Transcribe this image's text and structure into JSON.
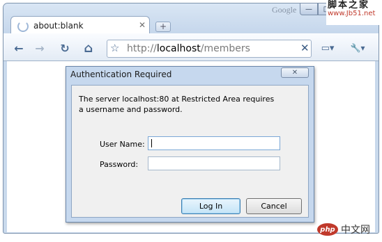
{
  "browser": {
    "brand": "Google",
    "window_controls": {
      "minimize": "—",
      "maximize": "□",
      "close": "✕"
    },
    "tab": {
      "title": "about:blank",
      "close": "✕"
    },
    "new_tab": "+",
    "address": {
      "scheme": "http://",
      "host": "localhost",
      "path": "/members"
    },
    "buttons": {
      "back": "←",
      "forward": "→",
      "reload": "↻",
      "home": "⌂",
      "star": "☆",
      "stop": "✕",
      "page": "▭▾",
      "wrench": "🔧▾"
    },
    "accent": "#4a6a92"
  },
  "watermark": {
    "top": "脚本之家",
    "bottom": "www.Jb51.net"
  },
  "dialog": {
    "title": "Authentication Required",
    "close": "✕",
    "message": "The server localhost:80 at Restricted Area requires a username and password.",
    "username_label": "User Name:",
    "password_label": "Password:",
    "username_value": "",
    "password_value": "",
    "login_label": "Log In",
    "cancel_label": "Cancel"
  },
  "site_badge": {
    "logo": "php",
    "text": "中文网"
  }
}
